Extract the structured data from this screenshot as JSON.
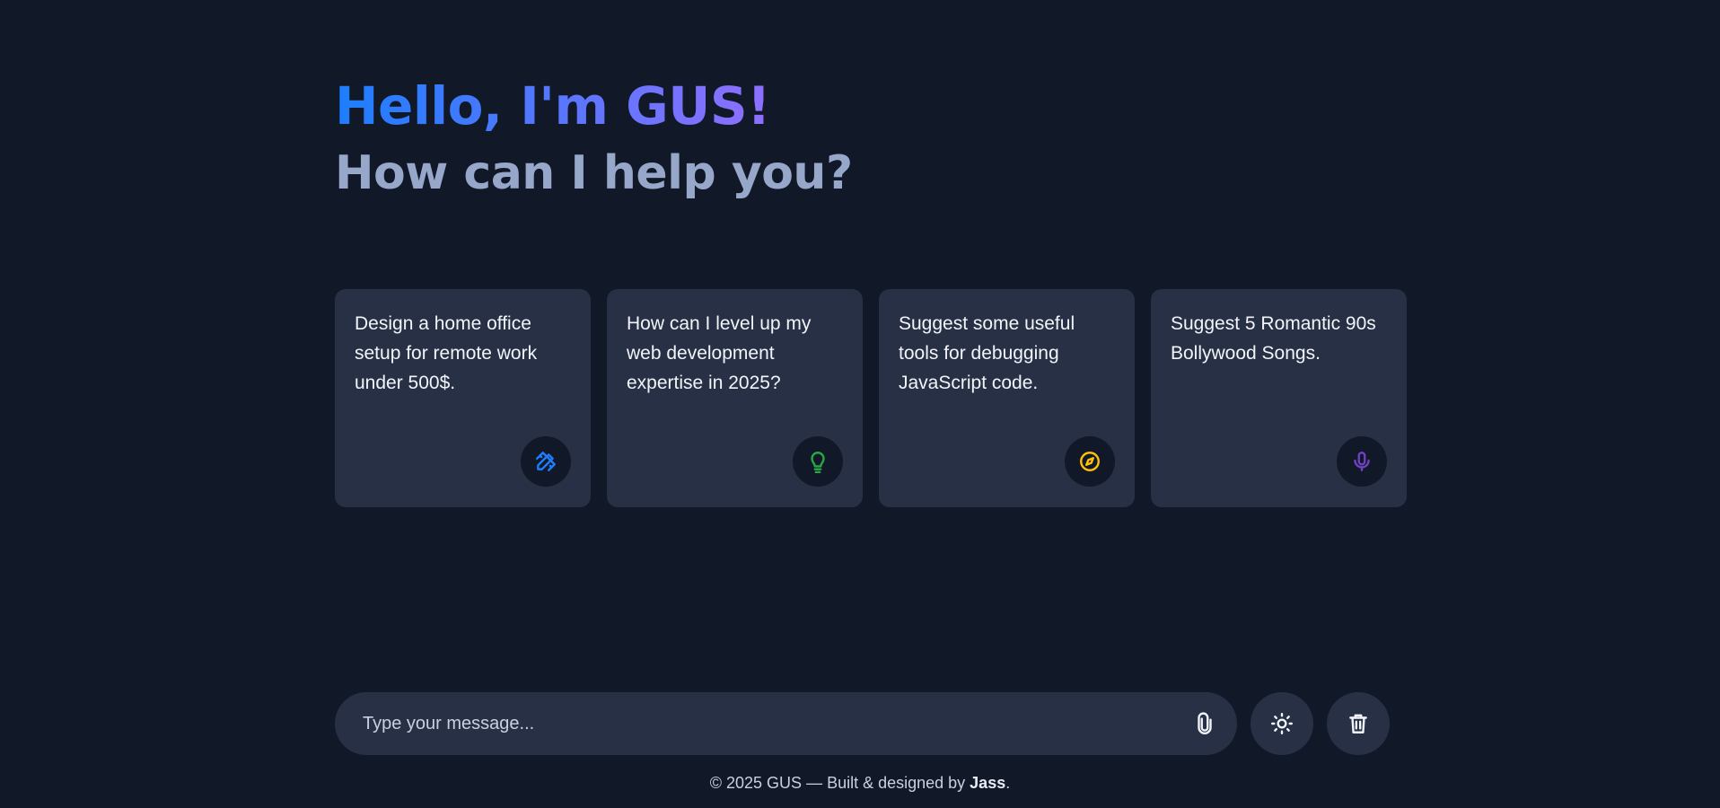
{
  "header": {
    "greeting": "Hello, I'm GUS!",
    "subheading": "How can I help you?"
  },
  "suggestions": [
    {
      "text": "Design a home office setup for remote work under 500$.",
      "icon": "pencil-ruler-icon",
      "icon_color": "#1d7efd"
    },
    {
      "text": "How can I level up my web development expertise in 2025?",
      "icon": "lightbulb-icon",
      "icon_color": "#28a745"
    },
    {
      "text": "Suggest some useful tools for debugging JavaScript code.",
      "icon": "compass-icon",
      "icon_color": "#ffc107"
    },
    {
      "text": "Suggest 5 Romantic 90s Bollywood Songs.",
      "icon": "microphone-icon",
      "icon_color": "#6f42c1"
    }
  ],
  "prompt": {
    "placeholder": "Type your message...",
    "attach_icon": "paperclip-icon",
    "theme_icon": "sun-icon",
    "delete_icon": "trash-icon"
  },
  "footer": {
    "prefix": "© 2025 GUS — Built & designed by ",
    "author": "Jass",
    "suffix": "."
  },
  "colors": {
    "background": "#111827",
    "card": "#283045",
    "gradient_start": "#1d7efd",
    "gradient_end": "#8f6fff",
    "subheading": "#97a7ca"
  }
}
